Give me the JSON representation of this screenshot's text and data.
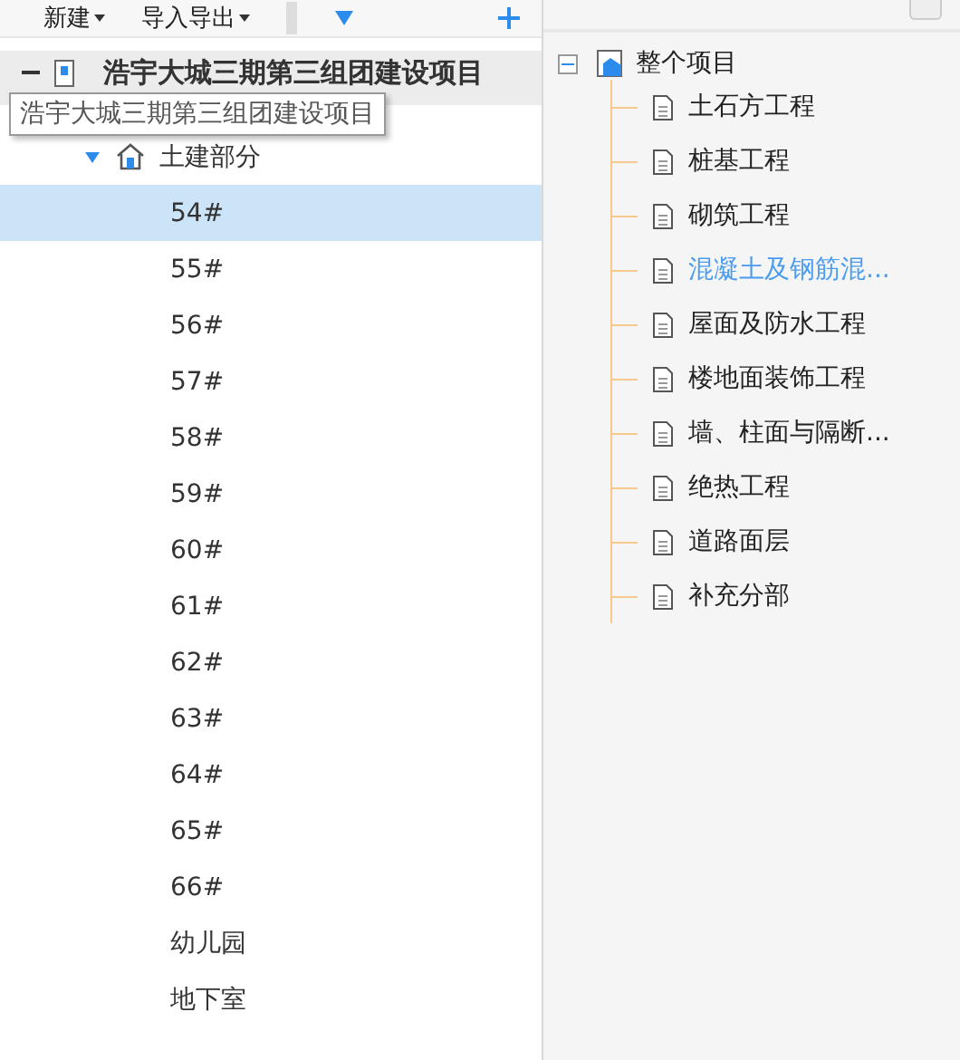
{
  "toolbar": {
    "menus": [
      {
        "label": "新建"
      },
      {
        "label": "导入导出"
      }
    ]
  },
  "project_tree": {
    "root": {
      "label": "浩宇大城三期第三组团建设项目",
      "expanded": true,
      "children": [
        {
          "label": "土建部分",
          "expanded": true,
          "children": [
            {
              "label": "54#",
              "selected": true
            },
            {
              "label": "55#",
              "selected": false
            },
            {
              "label": "56#",
              "selected": false
            },
            {
              "label": "57#",
              "selected": false
            },
            {
              "label": "58#",
              "selected": false
            },
            {
              "label": "59#",
              "selected": false
            },
            {
              "label": "60#",
              "selected": false
            },
            {
              "label": "61#",
              "selected": false
            },
            {
              "label": "62#",
              "selected": false
            },
            {
              "label": "63#",
              "selected": false
            },
            {
              "label": "64#",
              "selected": false
            },
            {
              "label": "65#",
              "selected": false
            },
            {
              "label": "66#",
              "selected": false
            },
            {
              "label": "幼儿园",
              "selected": false
            },
            {
              "label": "地下室",
              "selected": false
            }
          ]
        }
      ]
    },
    "tooltip": "浩宇大城三期第三组团建设项目"
  },
  "division_tree": {
    "label": "整个项目",
    "expanded": true,
    "children": [
      {
        "label": "土石方工程",
        "hovered": false
      },
      {
        "label": "桩基工程",
        "hovered": false
      },
      {
        "label": "砌筑工程",
        "hovered": false
      },
      {
        "label": "混凝土及钢筋混...",
        "hovered": true
      },
      {
        "label": "屋面及防水工程",
        "hovered": false
      },
      {
        "label": "楼地面装饰工程",
        "hovered": false
      },
      {
        "label": "墙、柱面与隔断...",
        "hovered": false
      },
      {
        "label": "绝热工程",
        "hovered": false
      },
      {
        "label": "道路面层",
        "hovered": false
      },
      {
        "label": "补充分部",
        "hovered": false
      }
    ]
  }
}
